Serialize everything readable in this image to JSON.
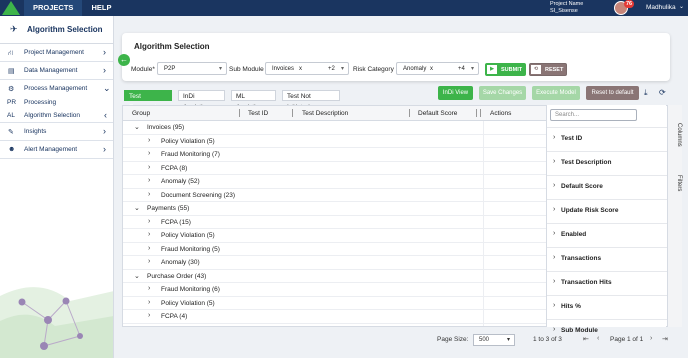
{
  "topbar": {
    "nav": [
      "PROJECTS",
      "HELP"
    ],
    "project_label": "Project Name",
    "project_value": "SI_Sisense",
    "notification_count": "76",
    "user_name": "Madhulika"
  },
  "sidebar": {
    "title": "Algorithm Selection",
    "menu": [
      {
        "label": "Project Management"
      },
      {
        "label": "Data Management"
      },
      {
        "label": "Process Management"
      },
      {
        "label": "Insights"
      },
      {
        "label": "Alert Management"
      }
    ],
    "sub_items": [
      {
        "abbr": "PR",
        "label": "Processing"
      },
      {
        "abbr": "AL",
        "label": "Algorithm Selection"
      }
    ]
  },
  "filters": {
    "title": "Algorithm Selection",
    "module_label": "Module*",
    "module_value": "P2P",
    "submodule_label": "Sub Module",
    "submodule_value": "Invoices",
    "submodule_more": "+2",
    "risk_label": "Risk Category",
    "risk_value": "Anomaly",
    "risk_more": "+4",
    "submit_label": "SUBMIT",
    "reset_label": "RESET"
  },
  "tabs": [
    "Test Executed",
    "InDi Analytics",
    "ML Analytics",
    "Test Not Initiated"
  ],
  "actions": {
    "indi_view": "InDi View",
    "save_changes": "Save Changes",
    "execute_model": "Execute Model",
    "reset_default": "Reset to default"
  },
  "grid": {
    "columns": [
      "Group",
      "Test ID",
      "Test Description",
      "Default Score",
      "Actions"
    ],
    "rows": [
      {
        "level": 0,
        "label": "Invoices (95)",
        "expanded": true
      },
      {
        "level": 1,
        "label": "Policy Violation (5)"
      },
      {
        "level": 1,
        "label": "Fraud Monitoring (7)"
      },
      {
        "level": 1,
        "label": "FCPA (8)"
      },
      {
        "level": 1,
        "label": "Anomaly (52)"
      },
      {
        "level": 1,
        "label": "Document Screening (23)"
      },
      {
        "level": 0,
        "label": "Payments (55)",
        "expanded": true
      },
      {
        "level": 1,
        "label": "FCPA (15)"
      },
      {
        "level": 1,
        "label": "Policy Violation (5)"
      },
      {
        "level": 1,
        "label": "Fraud Monitoring (5)"
      },
      {
        "level": 1,
        "label": "Anomaly (30)"
      },
      {
        "level": 0,
        "label": "Purchase Order (43)",
        "expanded": true
      },
      {
        "level": 1,
        "label": "Fraud Monitoring (6)"
      },
      {
        "level": 1,
        "label": "Policy Violation (5)"
      },
      {
        "level": 1,
        "label": "FCPA (4)"
      }
    ]
  },
  "column_panel": {
    "search_placeholder": "Search...",
    "items": [
      "Test ID",
      "Test Description",
      "Default Score",
      "Update Risk Score",
      "Enabled",
      "Transactions",
      "Transaction Hits",
      "Hits %",
      "Sub Module"
    ],
    "vtabs": [
      "Columns",
      "Filters"
    ]
  },
  "pagination": {
    "page_size_label": "Page Size:",
    "page_size": "500",
    "range": "1 to 3 of 3",
    "page_info": "Page 1 of 1"
  },
  "colors": {
    "navy": "#1a3560",
    "green": "#3db44a",
    "reset": "#8a7575"
  }
}
